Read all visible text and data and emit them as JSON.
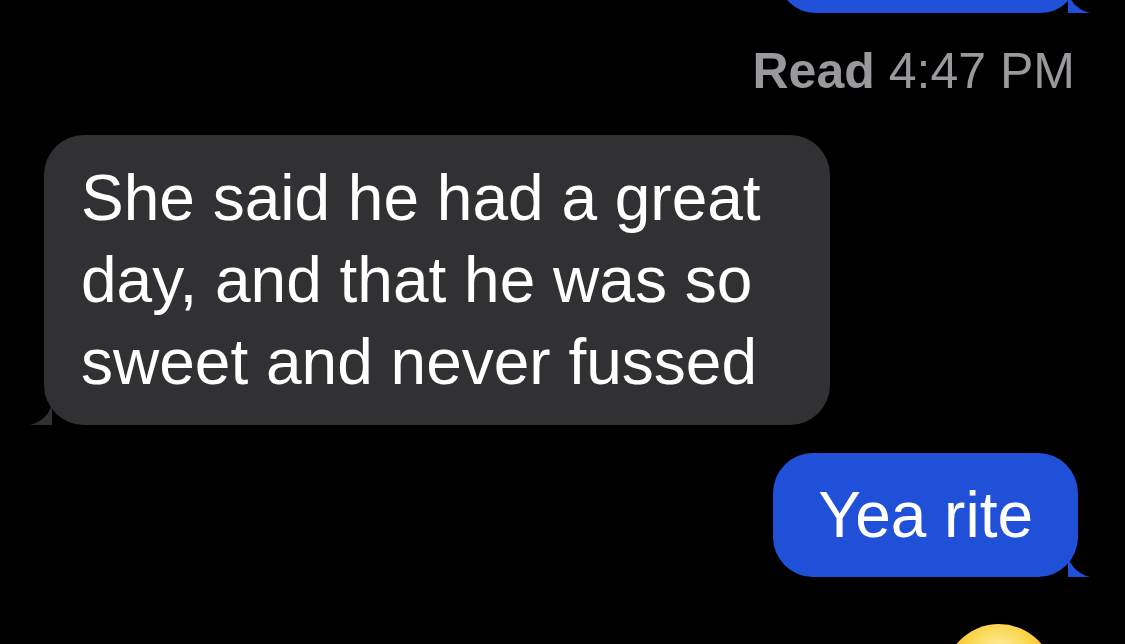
{
  "messages": [
    {
      "kind": "outgoing"
    },
    {
      "kind": "receipt",
      "label": "Read",
      "time": "4:47 PM"
    },
    {
      "kind": "incoming",
      "text": "She said he had a great day, and that he was so sweet and never fussed"
    },
    {
      "kind": "outgoing",
      "text": "Yea rite"
    },
    {
      "kind": "emoji"
    }
  ]
}
